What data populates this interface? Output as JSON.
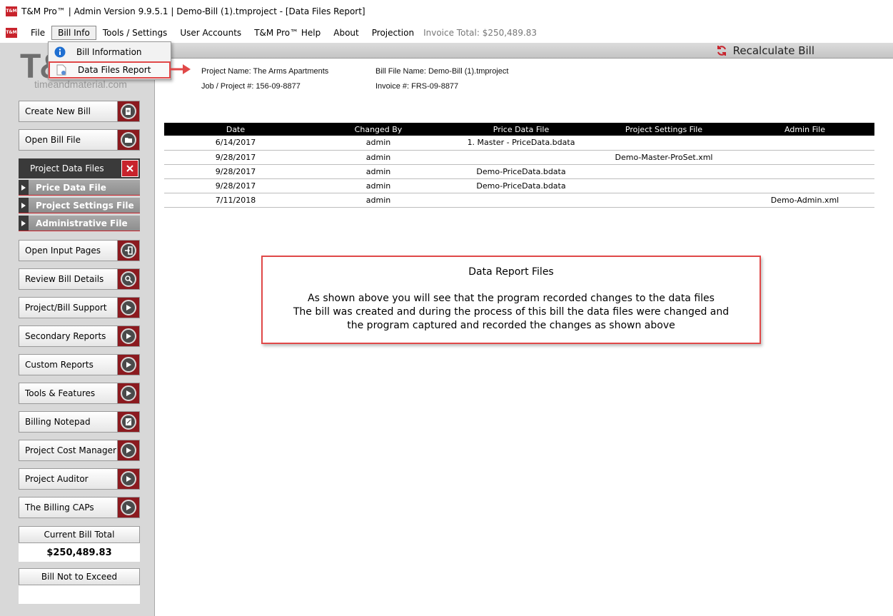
{
  "window": {
    "title": "T&M Pro™ | Admin Version 9.9.5.1 | Demo-Bill (1).tmproject - [Data Files Report]",
    "logo_text": "T&M"
  },
  "menubar": {
    "items": [
      "File",
      "Bill Info",
      "Tools / Settings",
      "User Accounts",
      "T&M Pro™ Help",
      "About",
      "Projection"
    ],
    "invoice_total": "Invoice Total: $250,489.83"
  },
  "dropdown": {
    "items": [
      "Bill Information",
      "Data Files Report"
    ]
  },
  "sidebar": {
    "brand": "T&",
    "brand_sub": "timeandmaterial.com",
    "top_buttons": [
      "Create New Bill",
      "Open Bill File"
    ],
    "project_data_files": {
      "label": "Project Data Files",
      "sub_items": [
        "Price Data File",
        "Project Settings File",
        "Administrative File"
      ]
    },
    "buttons": [
      "Open Input Pages",
      "Review Bill Details",
      "Project/Bill Support",
      "Secondary Reports",
      "Custom Reports",
      "Tools & Features",
      "Billing Notepad",
      "Project Cost Manager",
      "Project Auditor",
      "The Billing CAPs"
    ],
    "current_bill_total": {
      "label": "Current Bill Total",
      "value": "$250,489.83"
    },
    "bill_not_to_exceed": {
      "label": "Bill Not to Exceed",
      "value": ""
    }
  },
  "main": {
    "recalculate_label": "Recalculate Bill",
    "project": {
      "project_name": "Project Name: The Arms Apartments",
      "job_number": "Job / Project #: 156-09-8877",
      "bill_file_name": "Bill File Name: Demo-Bill (1).tmproject",
      "invoice_number": "Invoice #: FRS-09-8877"
    },
    "table": {
      "columns": [
        "Date",
        "Changed By",
        "Price Data File",
        "Project Settings File",
        "Admin File"
      ],
      "rows": [
        [
          "6/14/2017",
          "admin",
          "1. Master - PriceData.bdata",
          "",
          ""
        ],
        [
          "9/28/2017",
          "admin",
          "",
          "Demo-Master-ProSet.xml",
          ""
        ],
        [
          "9/28/2017",
          "admin",
          "Demo-PriceData.bdata",
          "",
          ""
        ],
        [
          "9/28/2017",
          "admin",
          "Demo-PriceData.bdata",
          "",
          ""
        ],
        [
          "7/11/2018",
          "admin",
          "",
          "",
          "Demo-Admin.xml"
        ]
      ]
    },
    "note": {
      "title": "Data Report Files",
      "lines": [
        "As shown above you will see that the program recorded changes to the data files",
        "The bill was created and during the process of this bill the data files were changed and",
        "the program captured and recorded the changes as shown above"
      ]
    }
  },
  "colors": {
    "accent_red": "#c8232c",
    "callout_red": "#e04848",
    "sidebar_bg": "#d8d8d8"
  }
}
